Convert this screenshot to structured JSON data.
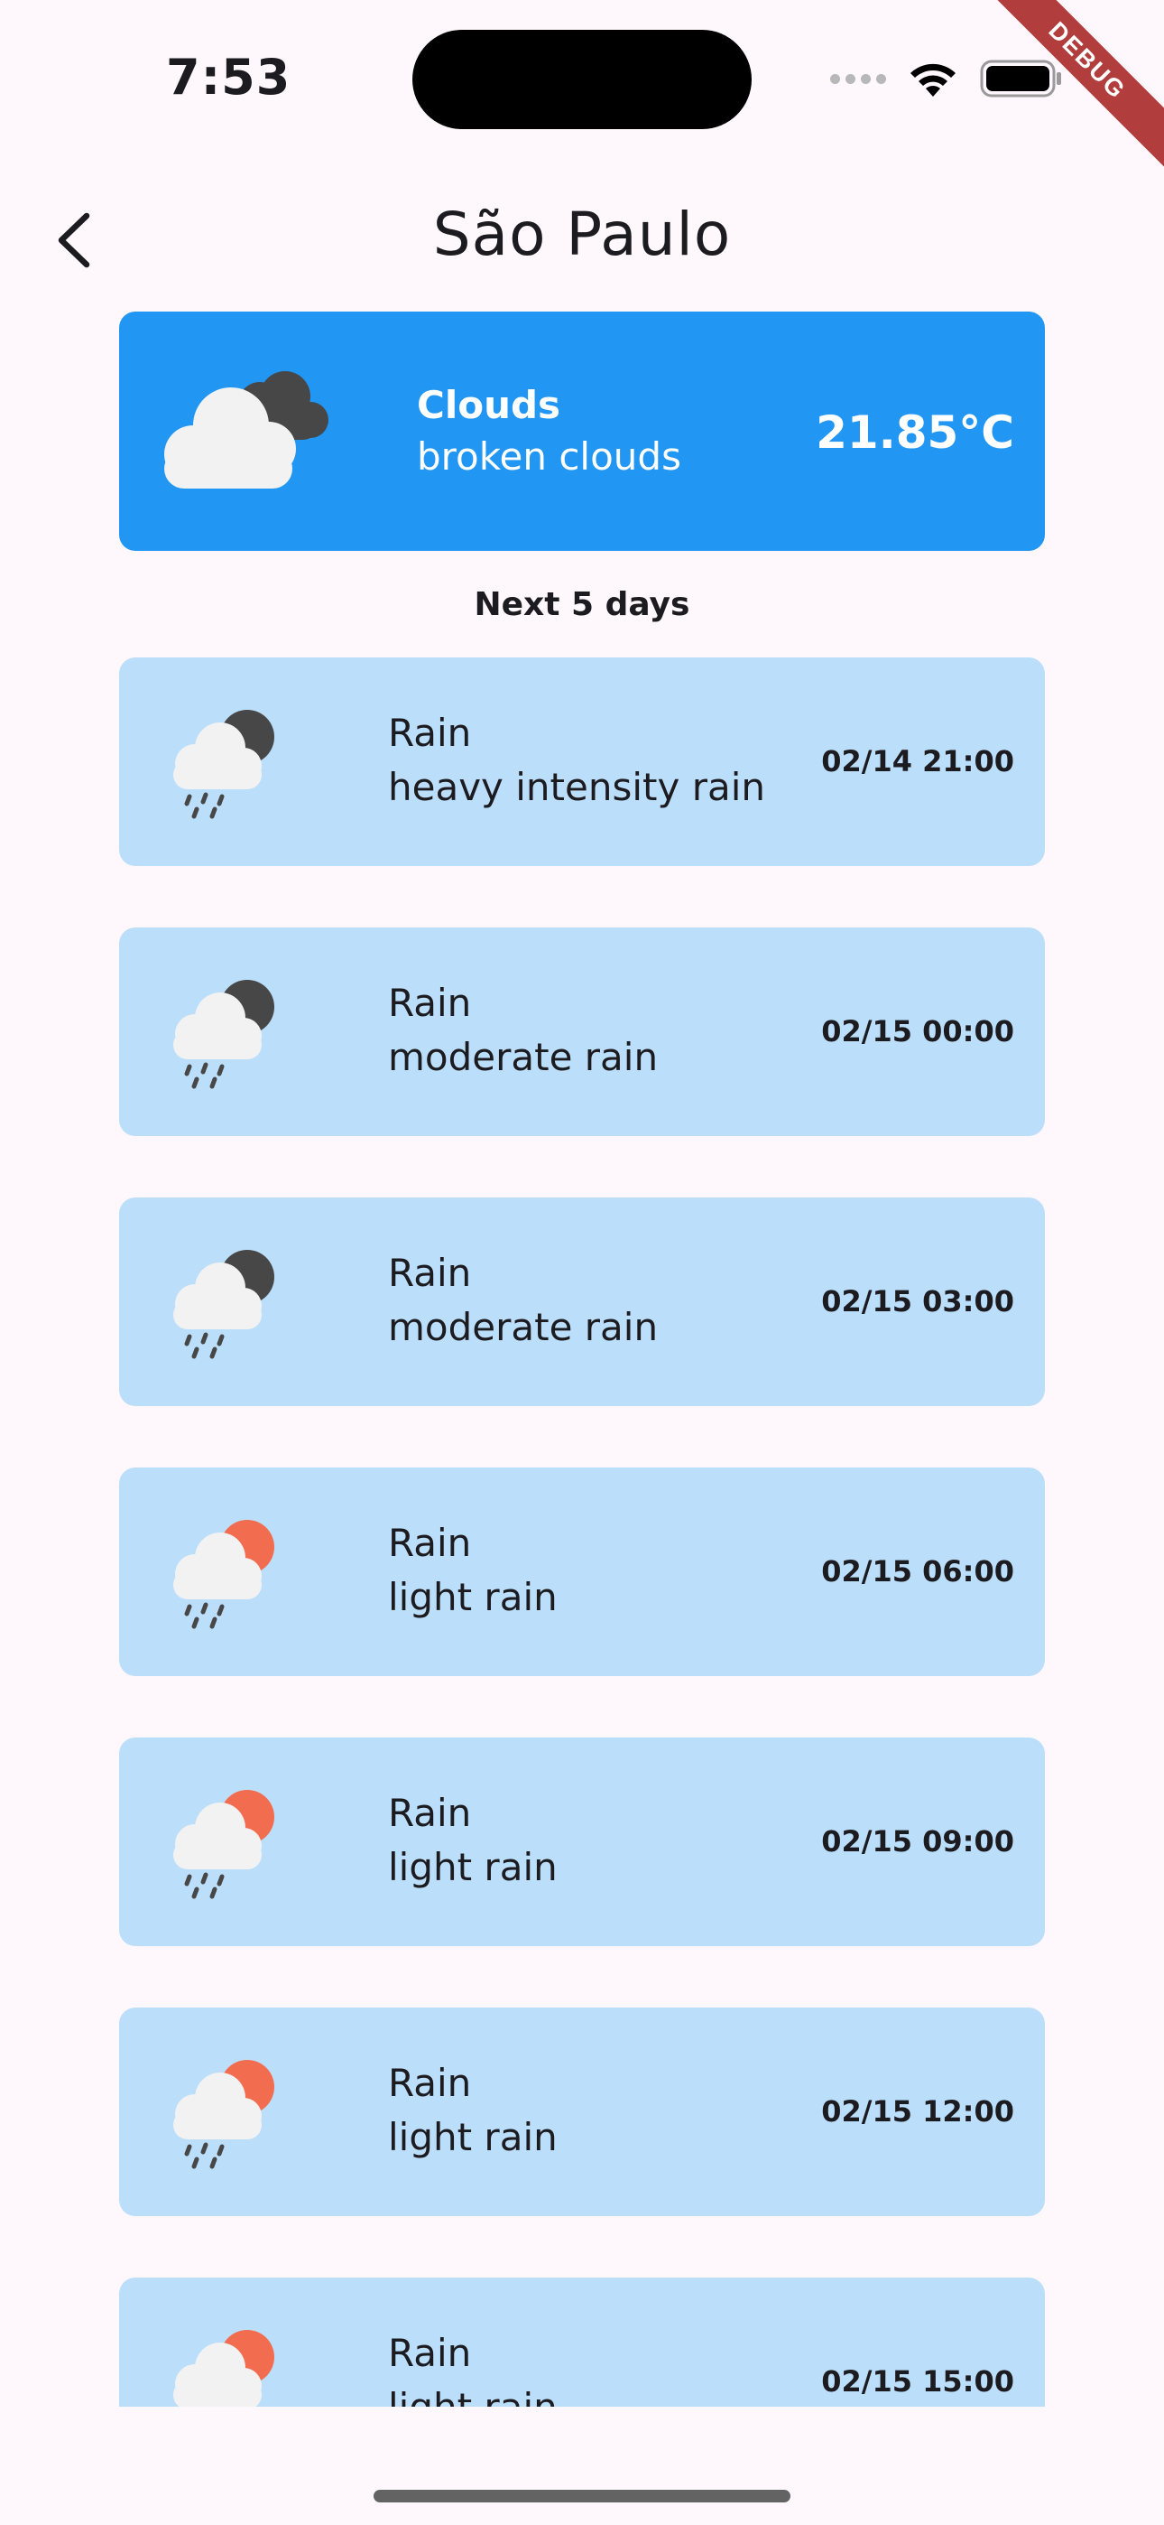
{
  "status_bar": {
    "time": "7:53",
    "debug_label": "DEBUG"
  },
  "header": {
    "title": "São Paulo",
    "back_icon": "chevron-left-icon"
  },
  "current": {
    "main": "Clouds",
    "description": "broken clouds",
    "temperature": "21.85°C",
    "icon": "broken-clouds-icon"
  },
  "forecast": {
    "title": "Next 5 days",
    "items": [
      {
        "main": "Rain",
        "description": "heavy intensity rain",
        "datetime": "02/14 21:00",
        "icon": "rain-night-icon"
      },
      {
        "main": "Rain",
        "description": "moderate rain",
        "datetime": "02/15 00:00",
        "icon": "rain-night-icon"
      },
      {
        "main": "Rain",
        "description": "moderate rain",
        "datetime": "02/15 03:00",
        "icon": "rain-night-icon"
      },
      {
        "main": "Rain",
        "description": "light rain",
        "datetime": "02/15 06:00",
        "icon": "rain-day-icon"
      },
      {
        "main": "Rain",
        "description": "light rain",
        "datetime": "02/15 09:00",
        "icon": "rain-day-icon"
      },
      {
        "main": "Rain",
        "description": "light rain",
        "datetime": "02/15 12:00",
        "icon": "rain-day-icon"
      },
      {
        "main": "Rain",
        "description": "light rain",
        "datetime": "02/15 15:00",
        "icon": "rain-day-icon"
      }
    ]
  },
  "colors": {
    "background": "#fef7fb",
    "current_card": "#2196f3",
    "forecast_card": "#bbdefb",
    "sun": "#f26c4f",
    "moon": "#474747",
    "cloud": "#f2f2f2"
  }
}
